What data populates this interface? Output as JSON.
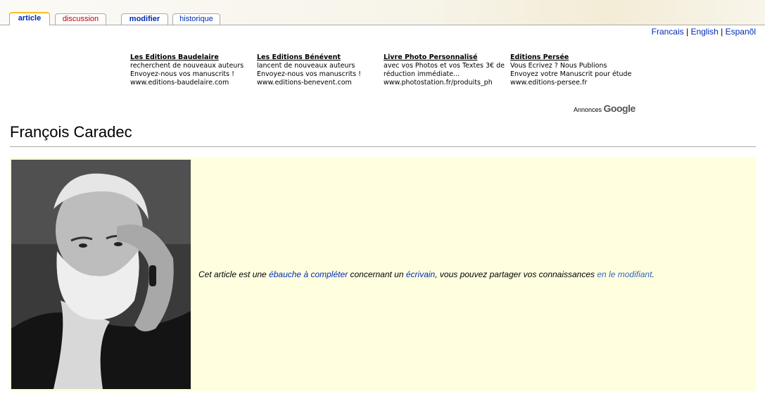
{
  "tabs": {
    "article": "article",
    "discussion": "discussion",
    "modifier": "modifier",
    "historique": "historique"
  },
  "languages": {
    "francais": "Francais",
    "english": "English",
    "espanol": "Espanõl",
    "separator": "|"
  },
  "ads": [
    {
      "title": "Les Editions Baudelaire",
      "text": "recherchent de nouveaux auteurs Envoyez-nous vos manuscrits !",
      "url": "www.editions-baudelaire.com"
    },
    {
      "title": "Les Editions Bénévent",
      "text": "lancent de nouveaux auteurs Envoyez-nous vos manuscrits !",
      "url": "www.editions-benevent.com"
    },
    {
      "title": "Livre Photo Personnalisé",
      "text": "avec vos Photos et vos Textes 3€ de réduction immédiate...",
      "url": "www.photostation.fr/produits_ph"
    },
    {
      "title": "Editions Persée",
      "text": "Vous Ecrivez ? Nous Publions Envoyez votre Manuscrit pour étude",
      "url": "www.editions-persee.fr"
    }
  ],
  "ads_label": {
    "annonces": "Annonces",
    "google": "Google"
  },
  "page_title": "François Caradec",
  "stub": {
    "part1": "Cet article est une ",
    "link1": "ébauche à compléter",
    "part2": " concernant un ",
    "link2": "écrivain",
    "part3": ", vous pouvez partager vos connaissances ",
    "link3": "en le modifiant",
    "part4": "."
  },
  "colors": {
    "link": "#002bb8",
    "link_light": "#3366bb",
    "new_link": "#ba0000",
    "stub_bg": "#ffffe0",
    "tab_accent": "#fabd23"
  }
}
